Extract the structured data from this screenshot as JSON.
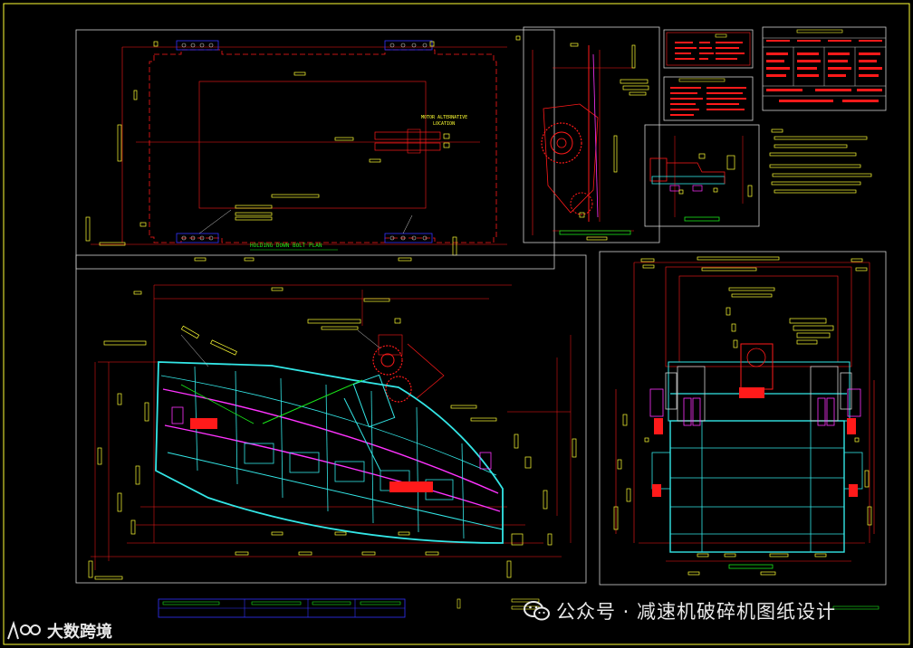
{
  "drawing": {
    "holding_down_bolt_plan_label": "HOLDING DOWN BOLT PLAN",
    "motor_note_line1": "MOTOR ALTERNATIVE",
    "motor_note_line2": "LOCATION"
  },
  "watermark": {
    "right_text": "公众号 · 减速机破碎机图纸设计",
    "left_text": "大数跨境"
  },
  "colors": {
    "background": "#000000",
    "line_red": "#ff1a1a",
    "line_yellow": "#ffff33",
    "line_cyan": "#33e6e6",
    "line_magenta": "#ff33ff",
    "line_green": "#19e619",
    "line_blue": "#3333ff",
    "line_white": "#d0d0d0"
  }
}
